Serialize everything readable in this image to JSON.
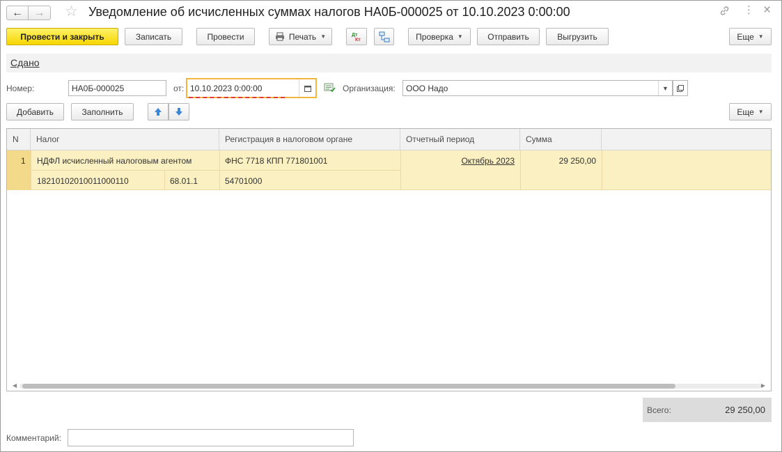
{
  "window": {
    "title": "Уведомление об исчисленных суммах налогов НА0Б-000025 от 10.10.2023 0:00:00",
    "nav_back": "←",
    "nav_forward": "→",
    "favorite_glyph": "☆",
    "link_glyph": "🔗",
    "menu_glyph": "⋮",
    "close_glyph": "×"
  },
  "toolbar": {
    "post_and_close": "Провести и закрыть",
    "save": "Записать",
    "post": "Провести",
    "print": "Печать",
    "check": "Проверка",
    "send": "Отправить",
    "export": "Выгрузить",
    "more": "Еще"
  },
  "status": {
    "link": "Сдано"
  },
  "header_fields": {
    "number_label": "Номер:",
    "number_value": "НА0Б-000025",
    "date_label": "от:",
    "date_value": "10.10.2023  0:00:00",
    "org_label": "Организация:",
    "org_value": "ООО Надо"
  },
  "table_toolbar": {
    "add": "Добавить",
    "fill": "Заполнить",
    "more": "Еще"
  },
  "table": {
    "columns": [
      "N",
      "Налог",
      "Регистрация в налоговом органе",
      "Отчетный период",
      "Сумма"
    ],
    "rows": [
      {
        "n": "1",
        "tax": "НДФЛ исчисленный налоговым агентом",
        "kbk": "18210102010011000110",
        "account": "68.01.1",
        "registration": "ФНС 7718 КПП 771801001",
        "oktmo": "54701000",
        "period": "Октябрь 2023",
        "amount": "29 250,00"
      }
    ]
  },
  "totals": {
    "label": "Всего:",
    "value": "29 250,00"
  },
  "comment": {
    "label": "Комментарий:",
    "value": ""
  },
  "colors": {
    "primary_button": "#f6d600",
    "selected_row": "#fbf0c2",
    "focus_border": "#f1b63e",
    "error_underline": "#e03a3a"
  }
}
